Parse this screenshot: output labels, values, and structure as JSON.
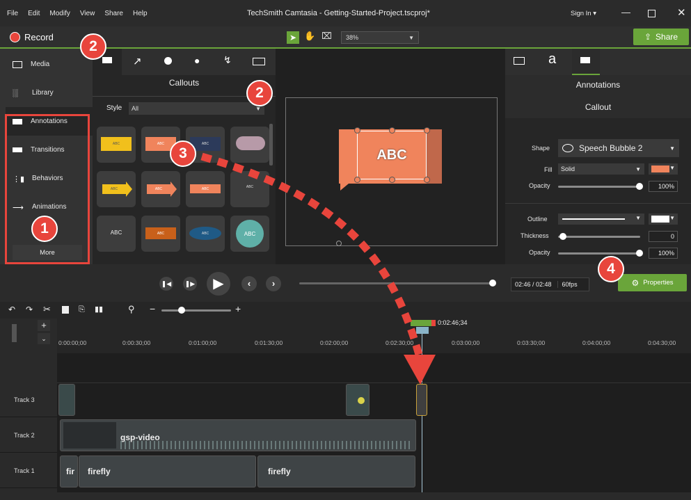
{
  "window": {
    "title": "TechSmith Camtasia - Getting-Started-Project.tscproj*"
  },
  "menu": [
    "File",
    "Edit",
    "Modify",
    "View",
    "Share",
    "Help"
  ],
  "signin": "Sign In ▾",
  "toolbar": {
    "record_label": "Record",
    "zoom": "38%",
    "share_label": "Share"
  },
  "nav": {
    "items": [
      {
        "label": "Media",
        "icon": "media-icon"
      },
      {
        "label": "Library",
        "icon": "library-icon"
      },
      {
        "label": "Annotations",
        "icon": "annotations-icon"
      },
      {
        "label": "Transitions",
        "icon": "transitions-icon"
      },
      {
        "label": "Behaviors",
        "icon": "behaviors-icon"
      },
      {
        "label": "Animations",
        "icon": "animations-icon"
      }
    ],
    "more": "More"
  },
  "callouts": {
    "heading": "Callouts",
    "style_label": "Style",
    "style_value": "All",
    "tiles": [
      "ABC",
      "ABC",
      "ABC",
      "",
      "ABC",
      "ABC",
      "ABC",
      "ABC",
      "ABC",
      "ABC",
      "ABC",
      "ABC"
    ]
  },
  "canvas": {
    "callout_text": "ABC"
  },
  "properties": {
    "heading": "Annotations",
    "subheading": "Callout",
    "shape_label": "Shape",
    "shape_value": "Speech Bubble 2",
    "fill_label": "Fill",
    "fill_value": "Solid",
    "opacity_label": "Opacity",
    "opacity_value": "100%",
    "outline_label": "Outline",
    "thickness_label": "Thickness",
    "thickness_value": "0",
    "opacity2_label": "Opacity",
    "opacity2_value": "100%",
    "properties_button": "Properties",
    "fill_color": "#f0845c"
  },
  "playback": {
    "time": "02:46 / 02:48",
    "fps": "60fps"
  },
  "timeline": {
    "playhead": "0:02:46;34",
    "ticks": [
      "0:00:00;00",
      "0:00:30;00",
      "0:01:00;00",
      "0:01:30;00",
      "0:02:00;00",
      "0:02:30;00",
      "0:03:00;00",
      "0:03:30;00",
      "0:04:00;00",
      "0:04:30;00"
    ],
    "tracks": [
      "Track 3",
      "Track 2",
      "Track 1"
    ],
    "clips": {
      "video": "gsp-video",
      "firefly_short": "fir",
      "firefly_a": "firefly",
      "firefly_b": "firefly"
    }
  },
  "steps": [
    "1",
    "2",
    "2",
    "3",
    "4"
  ],
  "colors": {
    "accent": "#6aa53a",
    "badge": "#e8453c",
    "record": "#e8453c"
  }
}
